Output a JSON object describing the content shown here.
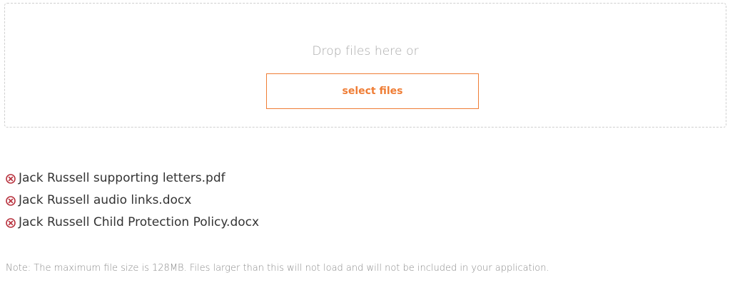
{
  "upload": {
    "drop_text": "Drop files here or",
    "select_label": "select files",
    "accent_color": "#ef7d35"
  },
  "files": [
    {
      "name": "Jack Russell supporting letters.pdf",
      "remove_icon": "remove-icon"
    },
    {
      "name": "Jack Russell audio links.docx",
      "remove_icon": "remove-icon"
    },
    {
      "name": "Jack Russell Child Protection Policy.docx",
      "remove_icon": "remove-icon"
    }
  ],
  "remove_icon_color": "#b8333f",
  "note": "Note: The maximum file size is 128MB. Files larger than this will not load and will not be included in your application."
}
